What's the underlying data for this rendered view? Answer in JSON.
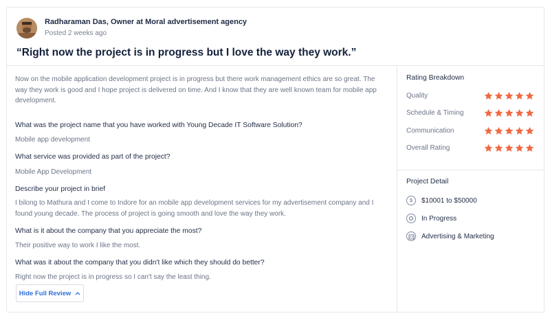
{
  "review": {
    "reviewer": "Radharaman Das, Owner at Moral advertisement agency",
    "posted": "Posted 2 weeks ago",
    "headline": "“Right now the project is in progress but I love the way they work.”",
    "description": "Now on the mobile application development project is in progress but there work management ethics are so great. The way they work is good and I hope project is delivered on time. And I know that they are well known team for mobile app development.",
    "qa": [
      {
        "q": "What was the project name that you have worked with Young Decade IT Software Solution?",
        "a": "Mobile app development"
      },
      {
        "q": "What service was provided as part of the project?",
        "a": "Mobile App Development"
      },
      {
        "q": "Describe your project in brief",
        "a": "I bilong to Mathura and I come to Indore for an mobile app development services for my advertisement company and I found young decade. The process of project is going smooth and love the way they work."
      },
      {
        "q": "What is it about the company that you appreciate the most?",
        "a": "Their positive way to work I like the most."
      },
      {
        "q": "What was it about the company that you didn't like which they should do better?",
        "a": "Right now the project is in progress so I can't say the least thing."
      }
    ],
    "toggle_label": "Hide Full Review"
  },
  "rating": {
    "title": "Rating Breakdown",
    "items": [
      {
        "label": "Quality",
        "stars": 5
      },
      {
        "label": "Schedule & Timing",
        "stars": 5
      },
      {
        "label": "Communication",
        "stars": 5
      },
      {
        "label": "Overall Rating",
        "stars": 5
      }
    ],
    "star_color": "#ee6a43"
  },
  "project_detail": {
    "title": "Project Detail",
    "items": [
      {
        "icon": "dollar-icon",
        "text": "$10001 to $50000"
      },
      {
        "icon": "progress-icon",
        "text": "In Progress"
      },
      {
        "icon": "building-icon",
        "text": "Advertising & Marketing"
      }
    ]
  },
  "colors": {
    "accent": "#2f6fd6",
    "star": "#ee6a43",
    "border": "#e3e6ec"
  }
}
